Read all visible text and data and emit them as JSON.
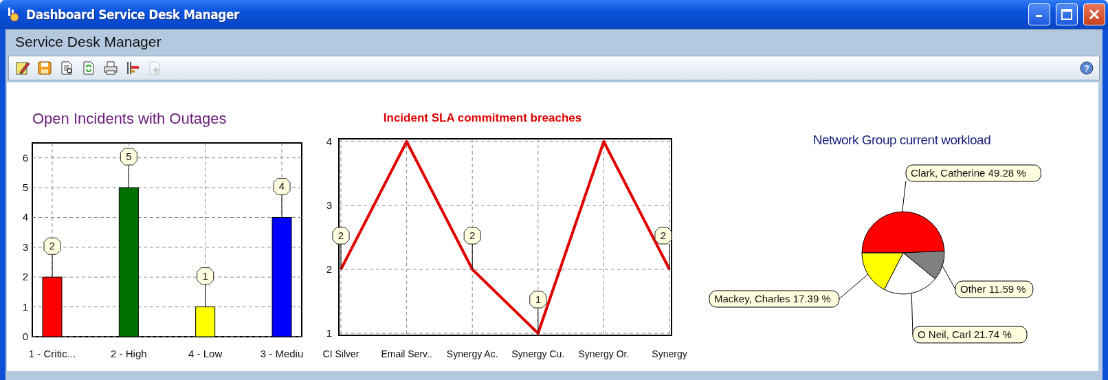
{
  "window": {
    "title": "Dashboard Service Desk Manager"
  },
  "header": {
    "title": "Service Desk Manager"
  },
  "toolbar": [
    {
      "kind": "edit",
      "disabled": false
    },
    {
      "kind": "save",
      "disabled": false
    },
    {
      "kind": "preview",
      "disabled": false
    },
    {
      "kind": "refresh",
      "disabled": false
    },
    {
      "kind": "print",
      "disabled": false
    },
    {
      "kind": "tree",
      "disabled": false
    },
    {
      "kind": "add",
      "disabled": true
    }
  ],
  "help": {
    "label": "?"
  },
  "panels": [
    {
      "chart_data": {
        "type": "bar",
        "title": "Open Incidents with Outages",
        "categories": [
          "1 - Critic...",
          "2 - High",
          "4 - Low",
          "3 - Mediu"
        ],
        "values": [
          2,
          5,
          1,
          4
        ],
        "colors": [
          "#ff0000",
          "#007000",
          "#ffff00",
          "#0000ff"
        ],
        "ylim": [
          0,
          6.5
        ],
        "yticks": [
          0,
          1,
          2,
          3,
          4,
          5,
          6
        ],
        "grid": true,
        "data_labels": true
      }
    },
    {
      "chart_data": {
        "type": "line",
        "title": "Incident SLA commitment breaches",
        "categories": [
          "CI Silver",
          "Email Serv..",
          "Synergy Ac.",
          "Synergy Cu.",
          "Synergy Or.",
          "Synergy"
        ],
        "series": [
          {
            "color": "#e00000",
            "values": [
              2,
              4,
              2,
              1,
              4,
              2
            ]
          }
        ],
        "ylim": [
          1,
          4
        ],
        "yticks": [
          1,
          2,
          3,
          4
        ],
        "grid": true,
        "value_labels": [
          "2",
          null,
          "2",
          "1",
          null,
          "2"
        ]
      }
    },
    {
      "chart_data": {
        "type": "pie",
        "title": "Network Group current workload",
        "categories": [
          "Clark, Catherine",
          "Other",
          "O Neil, Carl",
          "Mackey, Charles"
        ],
        "values": [
          49.28,
          11.59,
          21.74,
          17.39
        ],
        "colors": [
          "#ff0000",
          "#808080",
          "#ffffff",
          "#ffff00"
        ],
        "value_labels": [
          "49.28 %",
          "11.59 %",
          "21.74 %",
          "17.39 %"
        ]
      }
    }
  ]
}
